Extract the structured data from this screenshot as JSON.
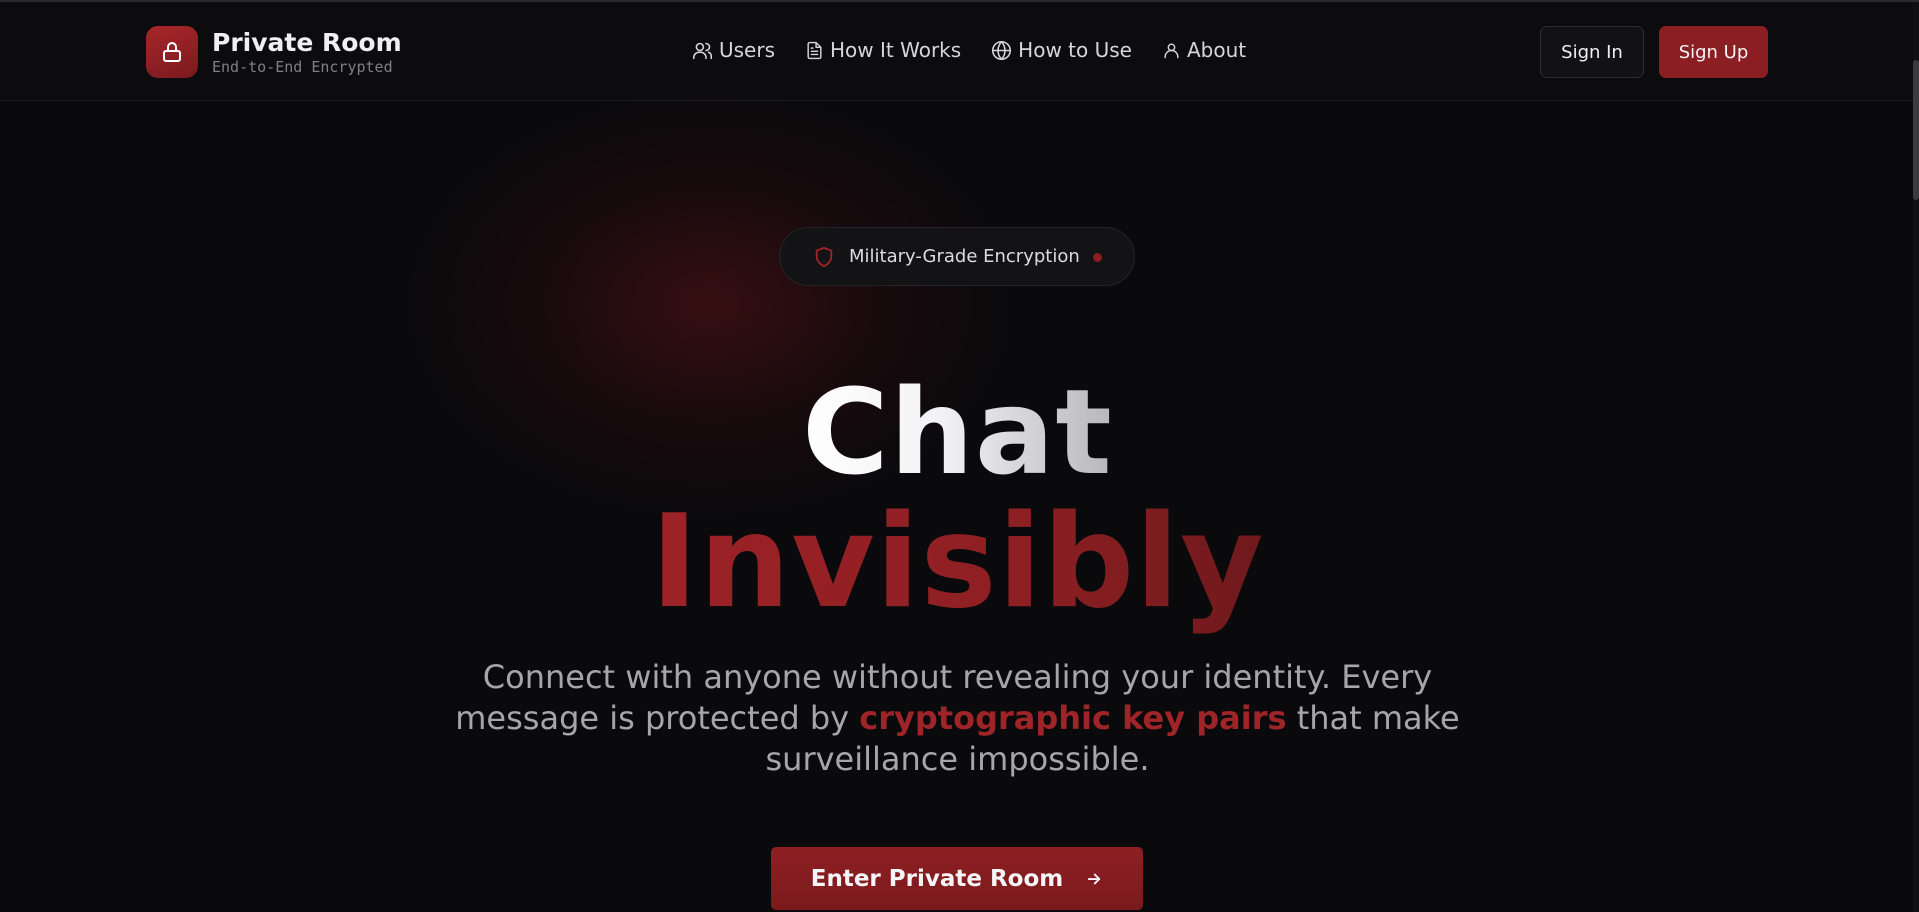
{
  "brand": {
    "title": "Private Room",
    "subtitle": "End-to-End Encrypted",
    "icon": "lock-icon"
  },
  "nav": {
    "items": [
      {
        "label": "Users",
        "icon": "users-icon"
      },
      {
        "label": "How It Works",
        "icon": "document-icon"
      },
      {
        "label": "How to Use",
        "icon": "globe-icon"
      },
      {
        "label": "About",
        "icon": "user-icon"
      }
    ]
  },
  "auth": {
    "sign_in": "Sign In",
    "sign_up": "Sign Up"
  },
  "badge": {
    "label": "Military-Grade Encryption",
    "icon": "shield-icon"
  },
  "hero": {
    "line1": "Chat",
    "line2": "Invisibly",
    "desc_before": "Connect with anyone without revealing your identity. Every message is protected by ",
    "desc_highlight": "cryptographic key pairs",
    "desc_after": " that make surveillance impossible.",
    "cta_label": "Enter Private Room",
    "cta_icon": "arrow-right-icon"
  },
  "colors": {
    "background": "#0a0a0c",
    "accent": "#8a1e22",
    "accent_text": "#9e2428"
  }
}
